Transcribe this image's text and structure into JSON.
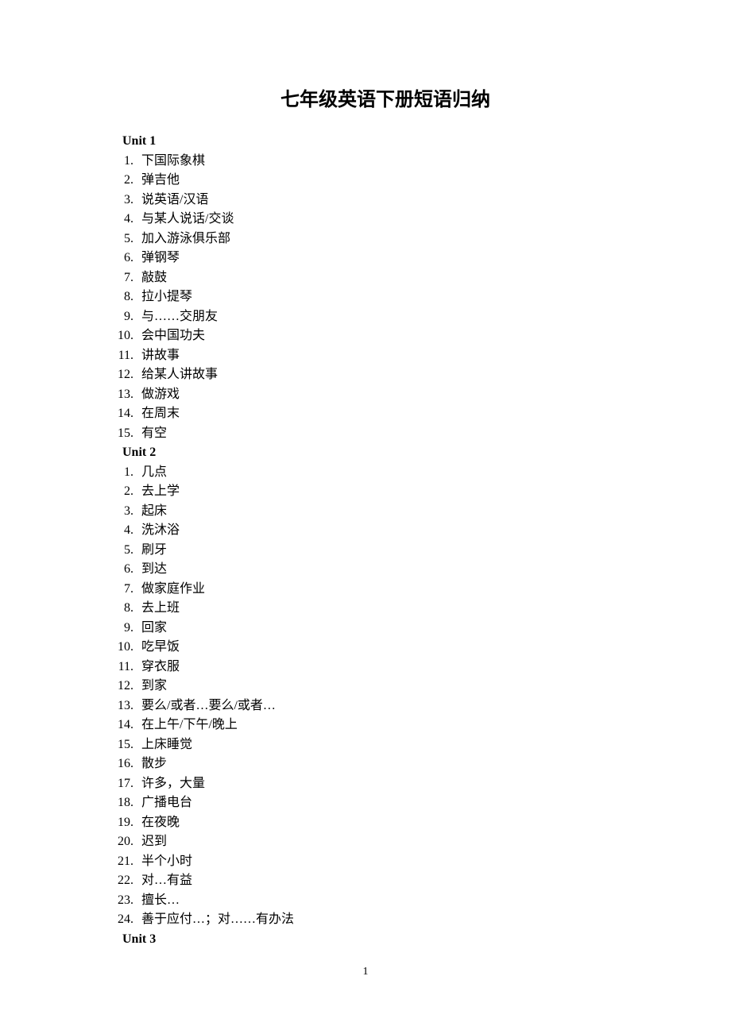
{
  "title": "七年级英语下册短语归纳",
  "pageNumber": "1",
  "units": [
    {
      "header": "Unit 1",
      "items": [
        "下国际象棋",
        "弹吉他",
        "说英语/汉语",
        "与某人说话/交谈",
        "加入游泳俱乐部",
        "弹钢琴",
        "敲鼓",
        "拉小提琴",
        "与……交朋友",
        "会中国功夫",
        "讲故事",
        "给某人讲故事",
        "做游戏",
        "在周末",
        "有空"
      ]
    },
    {
      "header": "Unit 2",
      "items": [
        "几点",
        "去上学",
        "起床",
        "洗沐浴",
        "刷牙",
        "到达",
        "做家庭作业",
        "去上班",
        "回家",
        "吃早饭",
        "穿衣服",
        "到家",
        "要么/或者…要么/或者…",
        "在上午/下午/晚上",
        "上床睡觉",
        "散步",
        "许多，大量",
        "广播电台",
        "在夜晚",
        "迟到",
        "半个小时",
        "对…有益",
        "擅长…",
        "善于应付…；对……有办法"
      ]
    },
    {
      "header": "Unit 3",
      "items": []
    }
  ]
}
